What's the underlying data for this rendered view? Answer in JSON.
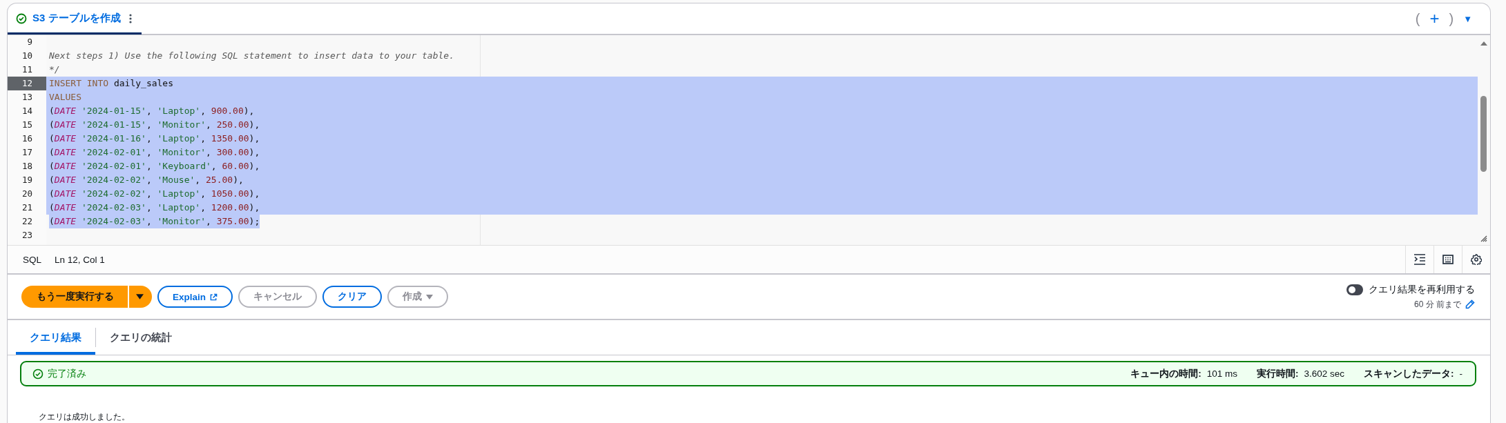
{
  "query_tab": {
    "title": "S3 テーブルを作成",
    "selected": true
  },
  "tab_actions": {
    "open": "(",
    "add": "+",
    "close": ")",
    "menu": "▼"
  },
  "editor": {
    "lines": [
      {
        "number": "9",
        "selected": false,
        "current": false
      },
      {
        "number": "10",
        "selected": false,
        "current": false,
        "tokens": [
          {
            "kind": "comment",
            "text": "Next steps 1) Use the following SQL statement to insert data to your table."
          }
        ]
      },
      {
        "number": "11",
        "selected": false,
        "current": false,
        "tokens": [
          {
            "kind": "comment",
            "text": "*/"
          }
        ]
      },
      {
        "number": "12",
        "selected": true,
        "current": true,
        "tokens": [
          {
            "kind": "keyword",
            "text": "INSERT INTO"
          },
          {
            "kind": "plain",
            "text": " daily_sales"
          }
        ]
      },
      {
        "number": "13",
        "selected": true,
        "current": false,
        "tokens": [
          {
            "kind": "keyword",
            "text": "VALUES"
          }
        ]
      },
      {
        "number": "14",
        "selected": true,
        "current": false,
        "tokens": [
          {
            "kind": "plain",
            "text": "("
          },
          {
            "kind": "type",
            "text": "DATE"
          },
          {
            "kind": "string",
            "text": "'2024-01-15'"
          },
          {
            "kind": "plain",
            "text": ", "
          },
          {
            "kind": "string",
            "text": "'Laptop'"
          },
          {
            "kind": "plain",
            "text": ", "
          },
          {
            "kind": "number",
            "text": "900.00"
          },
          {
            "kind": "plain",
            "text": "),"
          }
        ]
      },
      {
        "number": "15",
        "selected": true,
        "current": false,
        "tokens": [
          {
            "kind": "plain",
            "text": "("
          },
          {
            "kind": "type",
            "text": "DATE"
          },
          {
            "kind": "string",
            "text": "'2024-01-15'"
          },
          {
            "kind": "plain",
            "text": ", "
          },
          {
            "kind": "string",
            "text": "'Monitor'"
          },
          {
            "kind": "plain",
            "text": ", "
          },
          {
            "kind": "number",
            "text": "250.00"
          },
          {
            "kind": "plain",
            "text": "),"
          }
        ]
      },
      {
        "number": "16",
        "selected": true,
        "current": false,
        "tokens": [
          {
            "kind": "plain",
            "text": "("
          },
          {
            "kind": "type",
            "text": "DATE"
          },
          {
            "kind": "string",
            "text": "'2024-01-16'"
          },
          {
            "kind": "plain",
            "text": ", "
          },
          {
            "kind": "string",
            "text": "'Laptop'"
          },
          {
            "kind": "plain",
            "text": ", "
          },
          {
            "kind": "number",
            "text": "1350.00"
          },
          {
            "kind": "plain",
            "text": "),"
          }
        ]
      },
      {
        "number": "17",
        "selected": true,
        "current": false,
        "tokens": [
          {
            "kind": "plain",
            "text": "("
          },
          {
            "kind": "type",
            "text": "DATE"
          },
          {
            "kind": "string",
            "text": "'2024-02-01'"
          },
          {
            "kind": "plain",
            "text": ", "
          },
          {
            "kind": "string",
            "text": "'Monitor'"
          },
          {
            "kind": "plain",
            "text": ", "
          },
          {
            "kind": "number",
            "text": "300.00"
          },
          {
            "kind": "plain",
            "text": "),"
          }
        ]
      },
      {
        "number": "18",
        "selected": true,
        "current": false,
        "tokens": [
          {
            "kind": "plain",
            "text": "("
          },
          {
            "kind": "type",
            "text": "DATE"
          },
          {
            "kind": "string",
            "text": "'2024-02-01'"
          },
          {
            "kind": "plain",
            "text": ", "
          },
          {
            "kind": "string",
            "text": "'Keyboard'"
          },
          {
            "kind": "plain",
            "text": ", "
          },
          {
            "kind": "number",
            "text": "60.00"
          },
          {
            "kind": "plain",
            "text": "),"
          }
        ]
      },
      {
        "number": "19",
        "selected": true,
        "current": false,
        "tokens": [
          {
            "kind": "plain",
            "text": "("
          },
          {
            "kind": "type",
            "text": "DATE"
          },
          {
            "kind": "string",
            "text": "'2024-02-02'"
          },
          {
            "kind": "plain",
            "text": ", "
          },
          {
            "kind": "string",
            "text": "'Mouse'"
          },
          {
            "kind": "plain",
            "text": ", "
          },
          {
            "kind": "number",
            "text": "25.00"
          },
          {
            "kind": "plain",
            "text": "),"
          }
        ]
      },
      {
        "number": "20",
        "selected": true,
        "current": false,
        "tokens": [
          {
            "kind": "plain",
            "text": "("
          },
          {
            "kind": "type",
            "text": "DATE"
          },
          {
            "kind": "string",
            "text": "'2024-02-02'"
          },
          {
            "kind": "plain",
            "text": ", "
          },
          {
            "kind": "string",
            "text": "'Laptop'"
          },
          {
            "kind": "plain",
            "text": ", "
          },
          {
            "kind": "number",
            "text": "1050.00"
          },
          {
            "kind": "plain",
            "text": "),"
          }
        ]
      },
      {
        "number": "21",
        "selected": true,
        "current": false,
        "tokens": [
          {
            "kind": "plain",
            "text": "("
          },
          {
            "kind": "type",
            "text": "DATE"
          },
          {
            "kind": "string",
            "text": "'2024-02-03'"
          },
          {
            "kind": "plain",
            "text": ", "
          },
          {
            "kind": "string",
            "text": "'Laptop'"
          },
          {
            "kind": "plain",
            "text": ", "
          },
          {
            "kind": "number",
            "text": "1200.00"
          },
          {
            "kind": "plain",
            "text": "),"
          }
        ]
      },
      {
        "number": "22",
        "selected": true,
        "current": false,
        "tokens": [
          {
            "kind": "plain",
            "text": "("
          },
          {
            "kind": "type",
            "text": "DATE"
          },
          {
            "kind": "string",
            "text": "'2024-02-03'"
          },
          {
            "kind": "plain",
            "text": ", "
          },
          {
            "kind": "string",
            "text": "'Monitor'"
          },
          {
            "kind": "plain",
            "text": ", "
          },
          {
            "kind": "number",
            "text": "375.00"
          },
          {
            "kind": "plain",
            "text": ");"
          }
        ]
      },
      {
        "number": "23",
        "selected": false,
        "current": false
      }
    ]
  },
  "status_bar": {
    "language": "SQL",
    "position": "Ln 12, Col 1"
  },
  "actions": [
    {
      "kind": "primary",
      "label": "もう一度実行する"
    },
    {
      "kind": "link",
      "label": "Explain"
    },
    {
      "kind": "disabled",
      "label": "キャンセル"
    },
    {
      "kind": "normal",
      "label": "クリア"
    },
    {
      "kind": "disabled-menu",
      "label": "作成"
    }
  ],
  "reuse": {
    "label": "クエリ結果を再利用する",
    "on": false,
    "detail": "60 分 前まで"
  },
  "result_tabs": [
    {
      "label": "クエリ結果",
      "selected": true
    },
    {
      "label": "クエリの統計",
      "selected": false
    }
  ],
  "banner": {
    "status": "完了済み",
    "stats": [
      {
        "label": "キュー内の時間:",
        "value": "101 ms"
      },
      {
        "label": "実行時間:",
        "value": "3.602 sec"
      },
      {
        "label": "スキャンしたデータ:",
        "value": "-"
      }
    ]
  },
  "message": "クエリは成功しました。"
}
